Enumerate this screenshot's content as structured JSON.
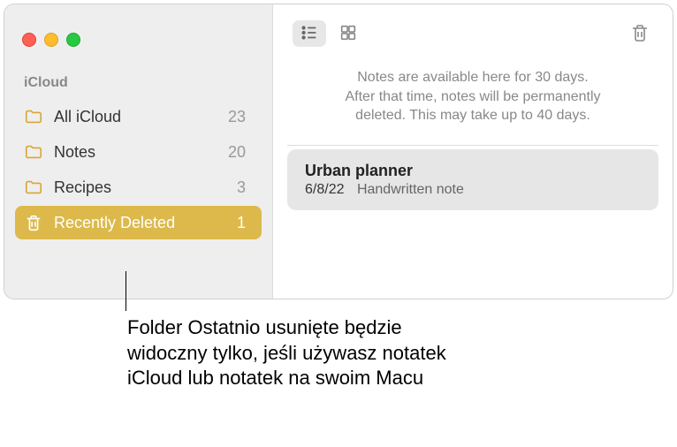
{
  "sidebar": {
    "section_header": "iCloud",
    "items": [
      {
        "label": "All iCloud",
        "count": "23"
      },
      {
        "label": "Notes",
        "count": "20"
      },
      {
        "label": "Recipes",
        "count": "3"
      },
      {
        "label": "Recently Deleted",
        "count": "1"
      }
    ]
  },
  "info": {
    "line1": "Notes are available here for 30 days.",
    "line2": "After that time, notes will be permanently",
    "line3": "deleted. This may take up to 40 days."
  },
  "notes": [
    {
      "title": "Urban planner",
      "date": "6/8/22",
      "subtitle": "Handwritten note"
    }
  ],
  "callout": "Folder Ostatnio usunięte będzie widoczny tylko, jeśli używasz notatek iCloud lub notatek na swoim Macu"
}
